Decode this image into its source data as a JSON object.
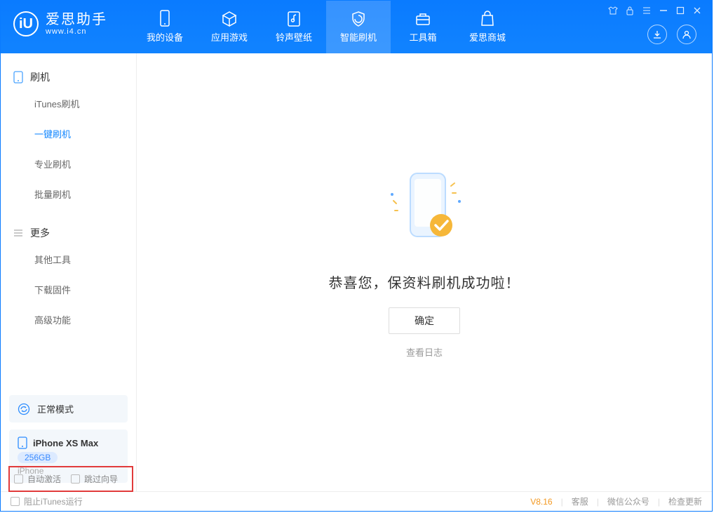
{
  "app": {
    "title": "爱思助手",
    "subtitle": "www.i4.cn",
    "logo_letter": "iU"
  },
  "nav": {
    "tabs": [
      {
        "label": "我的设备",
        "icon": "device"
      },
      {
        "label": "应用游戏",
        "icon": "cube"
      },
      {
        "label": "铃声壁纸",
        "icon": "music"
      },
      {
        "label": "智能刷机",
        "icon": "shield",
        "active": true
      },
      {
        "label": "工具箱",
        "icon": "toolbox"
      },
      {
        "label": "爱思商城",
        "icon": "bag"
      }
    ]
  },
  "sidebar": {
    "group1": {
      "title": "刷机",
      "items": [
        {
          "label": "iTunes刷机"
        },
        {
          "label": "一键刷机",
          "active": true
        },
        {
          "label": "专业刷机"
        },
        {
          "label": "批量刷机"
        }
      ]
    },
    "group2": {
      "title": "更多",
      "items": [
        {
          "label": "其他工具"
        },
        {
          "label": "下载固件"
        },
        {
          "label": "高级功能"
        }
      ]
    },
    "mode": "正常模式",
    "device": {
      "name": "iPhone XS Max",
      "storage": "256GB",
      "type": "iPhone"
    },
    "checks": {
      "auto_activate": "自动激活",
      "skip_guide": "跳过向导"
    }
  },
  "main": {
    "success_title": "恭喜您，保资料刷机成功啦！",
    "ok": "确定",
    "view_log": "查看日志"
  },
  "statusbar": {
    "block_itunes": "阻止iTunes运行",
    "version": "V8.16",
    "customer_service": "客服",
    "wechat": "微信公众号",
    "check_update": "检查更新"
  }
}
